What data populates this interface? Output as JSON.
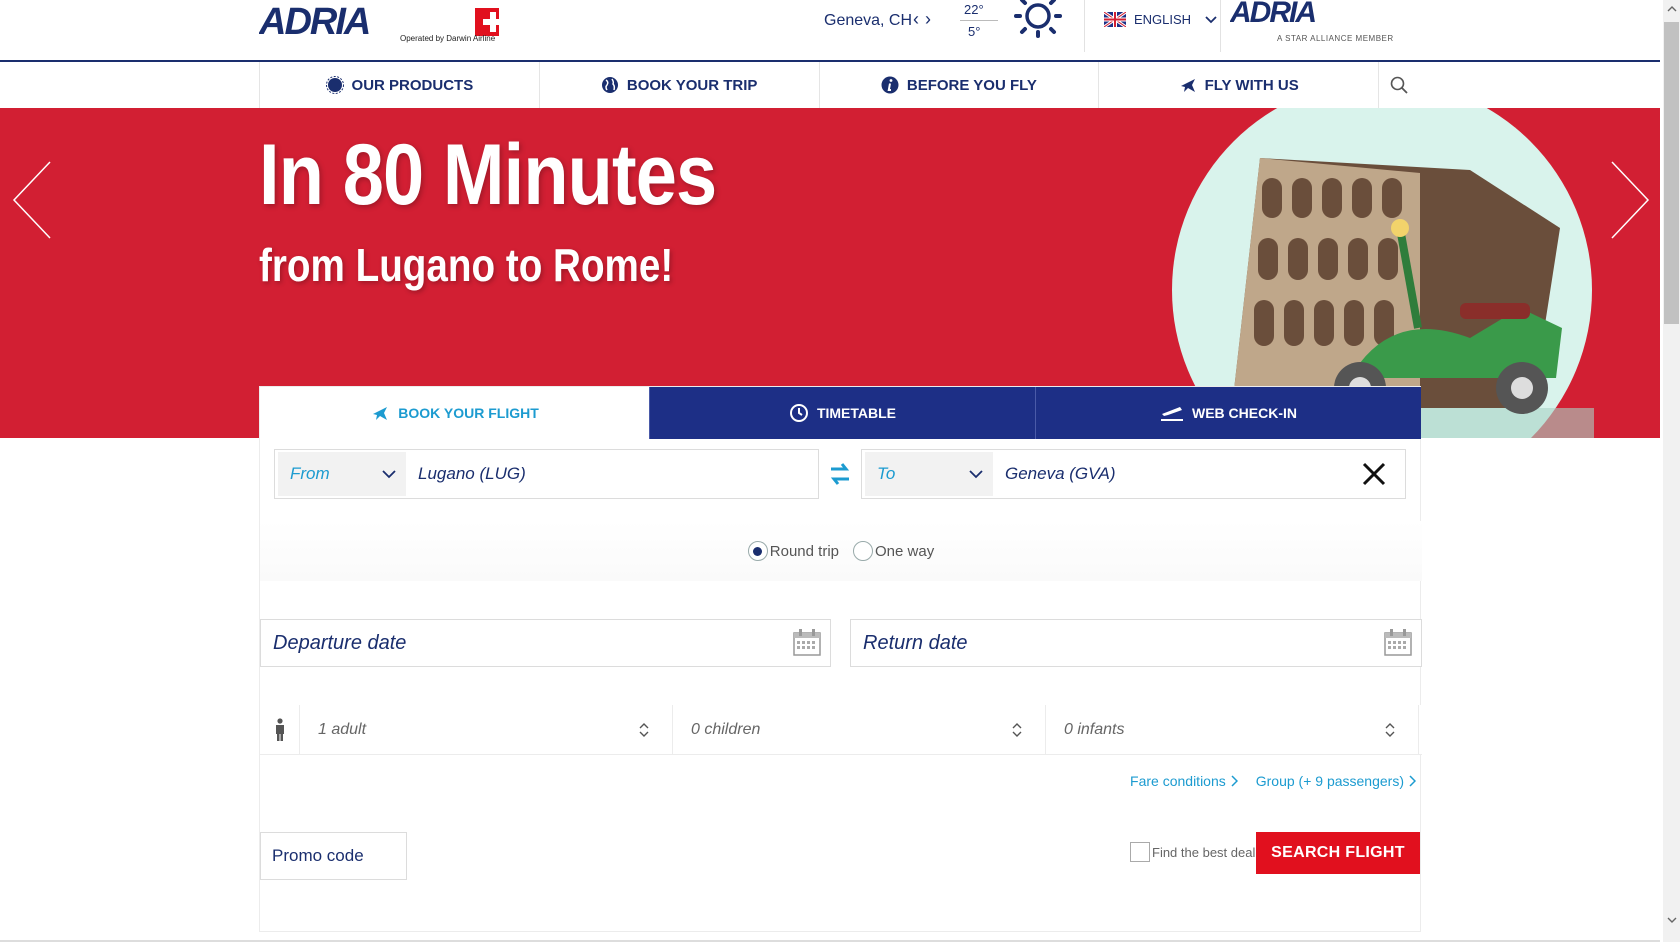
{
  "header": {
    "logo_sub": "Operated by Darwin Airline",
    "weather": {
      "city": "Geneva, CH",
      "temp_high": "22°",
      "temp_low": "5°"
    },
    "language": "ENGLISH",
    "partner_sub": "A STAR ALLIANCE MEMBER"
  },
  "nav": {
    "items": [
      {
        "label": "OUR PRODUCTS",
        "icon": "badge-icon"
      },
      {
        "label": "BOOK YOUR TRIP",
        "icon": "globe-icon"
      },
      {
        "label": "BEFORE YOU FLY",
        "icon": "info-icon"
      },
      {
        "label": "FLY WITH US",
        "icon": "plane-icon"
      }
    ]
  },
  "hero": {
    "title": "In 80 Minutes",
    "subtitle": "from Lugano to Rome!"
  },
  "booking": {
    "tabs": [
      {
        "label": "BOOK YOUR FLIGHT",
        "icon": "plane-icon"
      },
      {
        "label": "TIMETABLE",
        "icon": "clock-icon"
      },
      {
        "label": "WEB CHECK-IN",
        "icon": "departure-icon"
      }
    ],
    "from": {
      "label": "From",
      "value": "Lugano (LUG)"
    },
    "to": {
      "label": "To",
      "value": "Geneva (GVA)"
    },
    "trip_types": [
      {
        "label": "Round trip",
        "selected": true
      },
      {
        "label": "One way",
        "selected": false
      }
    ],
    "departure_placeholder": "Departure date",
    "return_placeholder": "Return date",
    "passengers": {
      "adults": "1 adult",
      "children": "0 children",
      "infants": "0 infants"
    },
    "links": {
      "fare_conditions": "Fare conditions",
      "group": "Group (+ 9 passengers)"
    },
    "promo_label": "Promo code",
    "best_deal_label": "Find the best deal",
    "search_label": "SEARCH FLIGHT"
  },
  "colors": {
    "brand_navy": "#1a2e6e",
    "tab_navy": "#1d2f86",
    "hero_red": "#d21f33",
    "accent_blue": "#1c9bd0",
    "cta_red": "#e1101e"
  }
}
